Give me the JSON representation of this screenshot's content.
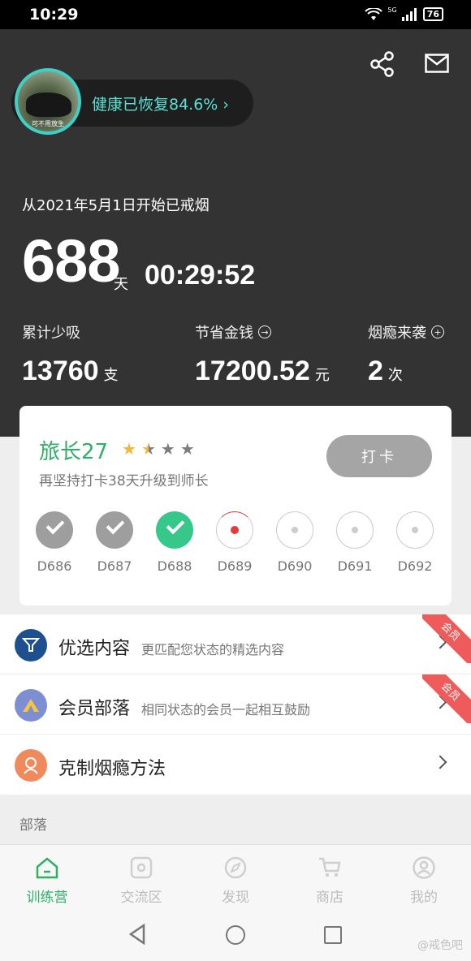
{
  "status_bar": {
    "time": "10:29",
    "signal_label": "5G",
    "battery": "76"
  },
  "header": {
    "health_text": "健康已恢复84.6%",
    "avatar_caption": "可不用放生",
    "since_text": "从2021年5月1日开始已戒烟",
    "days": "688",
    "days_unit": "天",
    "timer": "00:29:52",
    "stats": [
      {
        "label": "累计少吸",
        "value": "13760",
        "unit": "支",
        "icon": ""
      },
      {
        "label": "节省金钱",
        "value": "17200.52",
        "unit": "元",
        "icon": "arrow-right-circle-icon"
      },
      {
        "label": "烟瘾来袭",
        "value": "2",
        "unit": "次",
        "icon": "plus-circle-icon"
      }
    ]
  },
  "level": {
    "rank": "旅长27",
    "stars_filled": 1.5,
    "stars_total": 4,
    "subtitle": "再坚持打卡38天升级到师长",
    "checkin_label": "打卡",
    "days": [
      {
        "label": "D686",
        "state": "done"
      },
      {
        "label": "D687",
        "state": "done"
      },
      {
        "label": "D688",
        "state": "today"
      },
      {
        "label": "D689",
        "state": "next"
      },
      {
        "label": "D690",
        "state": "future"
      },
      {
        "label": "D691",
        "state": "future"
      },
      {
        "label": "D692",
        "state": "future"
      }
    ]
  },
  "menu": [
    {
      "title": "优选内容",
      "subtitle": "更匹配您状态的精选内容",
      "badge": "会员",
      "icon": "filter-list-icon",
      "color": "#1e4f8f"
    },
    {
      "title": "会员部落",
      "subtitle": "相同状态的会员一起相互鼓励",
      "badge": "会员",
      "icon": "triangle-tent-icon",
      "color": "#7d8fd0"
    },
    {
      "title": "克制烟瘾方法",
      "subtitle": "",
      "badge": "",
      "icon": "person-bust-icon",
      "color": "#f08a5d"
    }
  ],
  "section_title": "部落",
  "bottom_nav": [
    {
      "label": "训练营",
      "icon": "home-icon",
      "active": true
    },
    {
      "label": "交流区",
      "icon": "chat-square-icon",
      "active": false
    },
    {
      "label": "发现",
      "icon": "compass-icon",
      "active": false
    },
    {
      "label": "商店",
      "icon": "cart-icon",
      "active": false
    },
    {
      "label": "我的",
      "icon": "user-icon",
      "active": false
    }
  ],
  "watermark": "@戒色吧",
  "colors": {
    "accent_green": "#2fb067",
    "teal": "#5ce0d4",
    "dark_bg": "#333333",
    "ribbon_red": "#ef5b5b"
  }
}
